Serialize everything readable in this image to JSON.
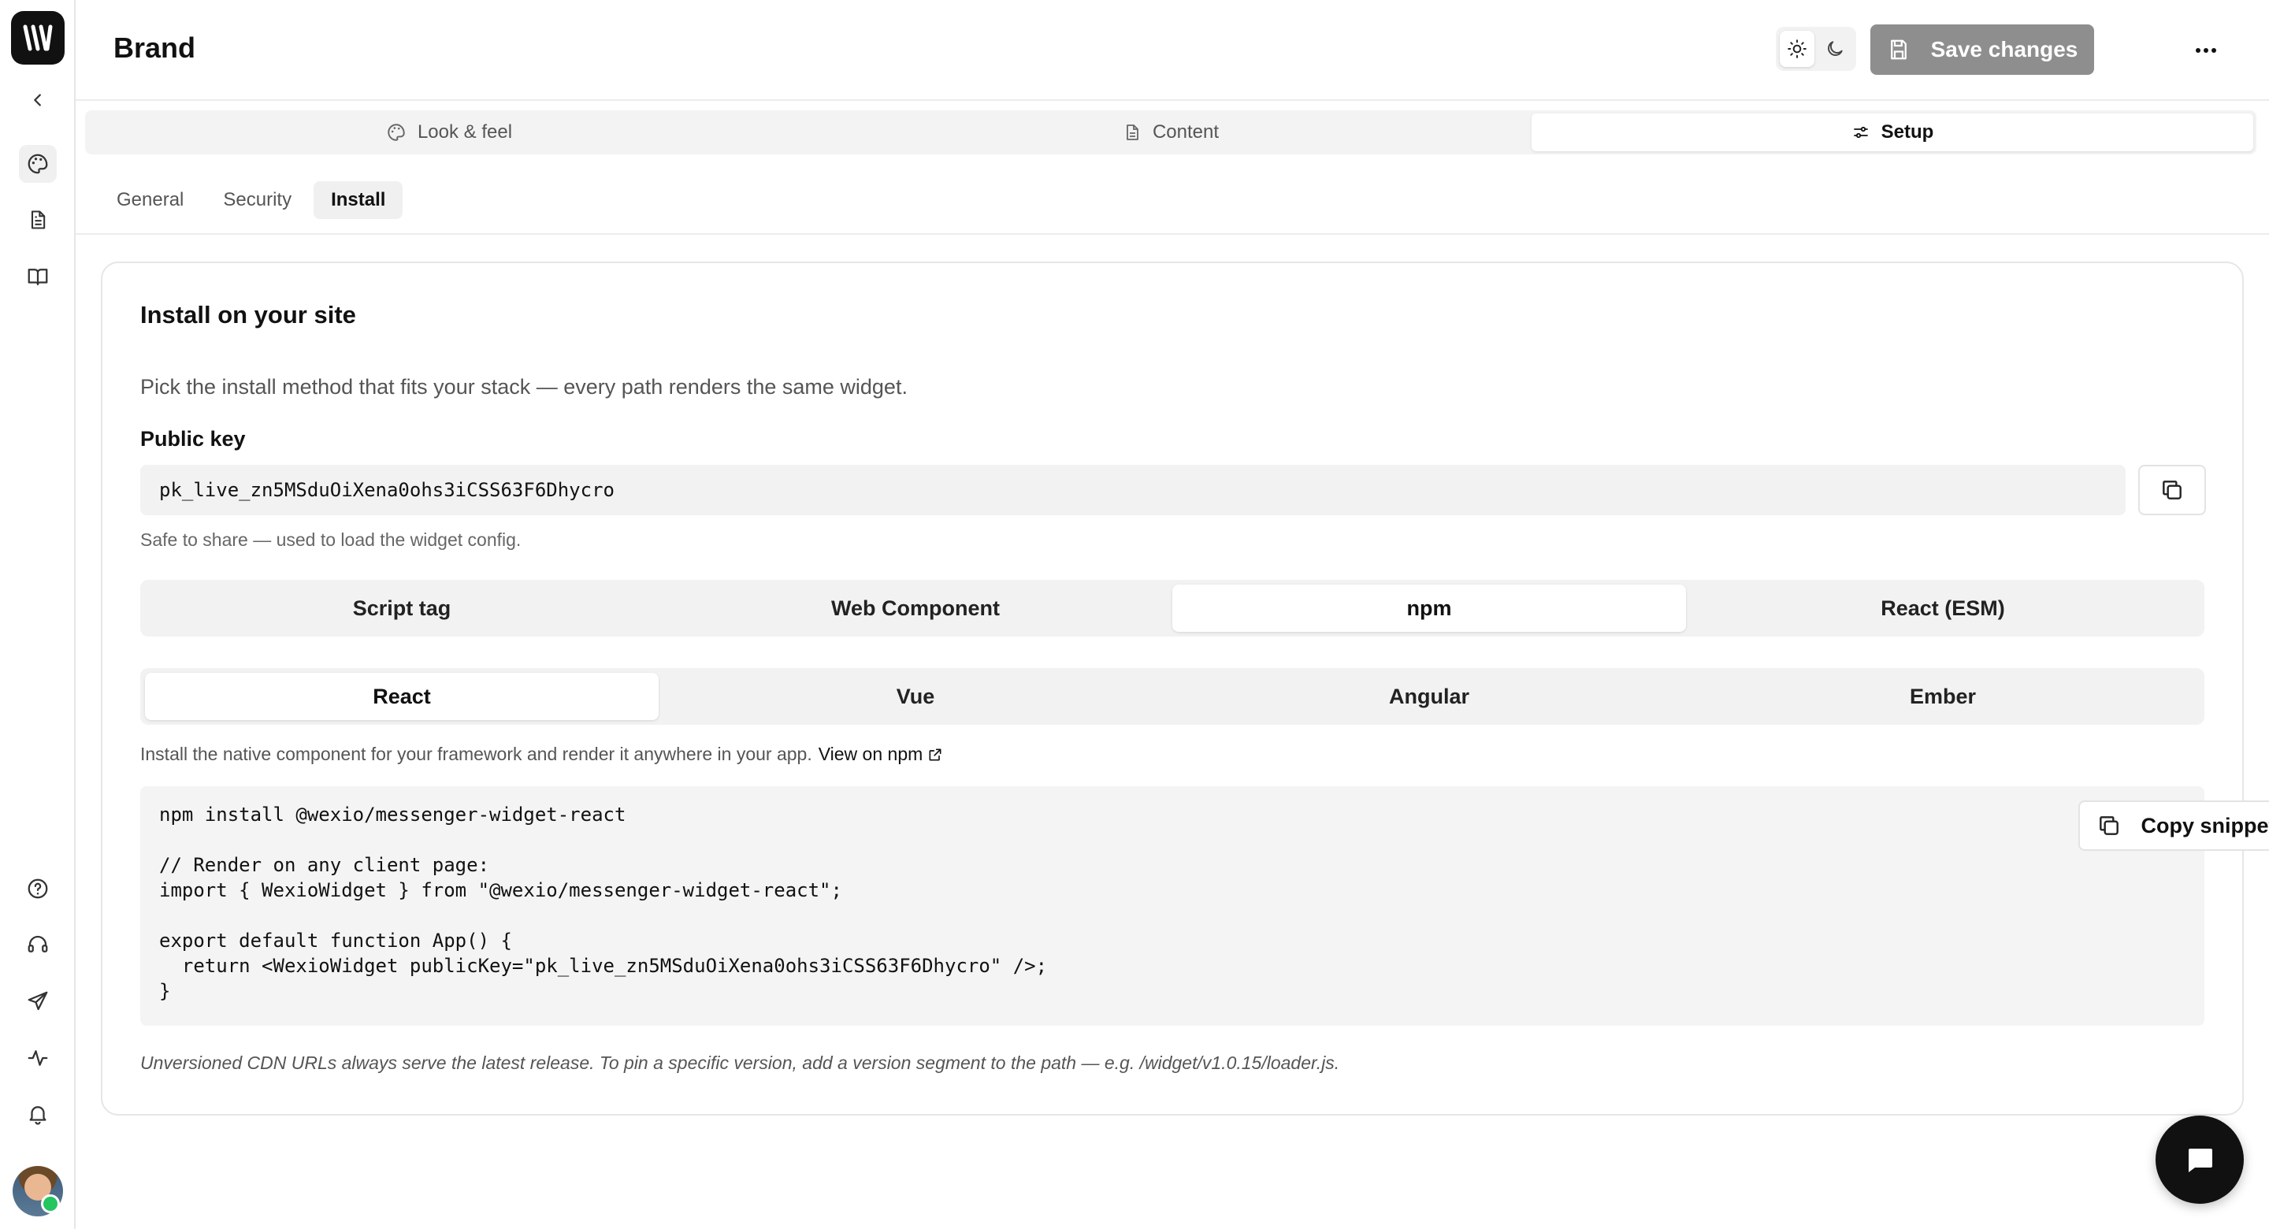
{
  "app": {
    "page_title": "Brand",
    "logo_glyph": "W"
  },
  "sidebar": {
    "icons": [
      "collapse-chevron-icon",
      "palette-icon",
      "document-icon",
      "book-icon",
      "help-icon",
      "headset-icon",
      "send-icon",
      "activity-icon",
      "bell-icon"
    ]
  },
  "header": {
    "save_label": "Save changes",
    "theme_light_icon": "sun-icon",
    "theme_dark_icon": "moon-icon",
    "more_icon": "more-horizontal-icon"
  },
  "section_tabs": [
    {
      "label": "Look & feel",
      "icon": "palette-icon",
      "active": false
    },
    {
      "label": "Content",
      "icon": "document-icon",
      "active": false
    },
    {
      "label": "Setup",
      "icon": "sliders-icon",
      "active": true
    }
  ],
  "sub_tabs": [
    {
      "label": "General",
      "active": false
    },
    {
      "label": "Security",
      "active": false
    },
    {
      "label": "Install",
      "active": true
    }
  ],
  "install": {
    "title": "Install on your site",
    "description": "Pick the install method that fits your stack — every path renders the same widget.",
    "public_key_label": "Public key",
    "public_key_value": "pk_live_zn5MSduOiXena0ohs3iCSS63F6Dhycro",
    "public_key_help": "Safe to share — used to load the widget config.",
    "methods": [
      {
        "label": "Script tag",
        "active": false
      },
      {
        "label": "Web Component",
        "active": false
      },
      {
        "label": "npm",
        "active": true
      },
      {
        "label": "React (ESM)",
        "active": false
      }
    ],
    "frameworks": [
      {
        "label": "React",
        "active": true
      },
      {
        "label": "Vue",
        "active": false
      },
      {
        "label": "Angular",
        "active": false
      },
      {
        "label": "Ember",
        "active": false
      }
    ],
    "framework_help": "Install the native component for your framework and render it anywhere in your app.",
    "npm_link_label": "View on npm",
    "code_lines": [
      "npm install @wexio/messenger-widget-react",
      "",
      "// Render on any client page:",
      "import { WexioWidget } from \"@wexio/messenger-widget-react\";",
      "",
      "export default function App() {",
      "  return <WexioWidget publicKey=\"pk_live_zn5MSduOiXena0ohs3iCSS63F6Dhycro\" />;",
      "}"
    ],
    "copy_snippet_label": "Copy snippet",
    "footnote": "Unversioned CDN URLs always serve the latest release. To pin a specific version, add a version segment to the path — e.g. /widget/v1.0.15/loader.js."
  },
  "colors": {
    "save_button_bg": "#8e8e8e",
    "status_online": "#22c55e",
    "fab_bg": "#111111"
  }
}
